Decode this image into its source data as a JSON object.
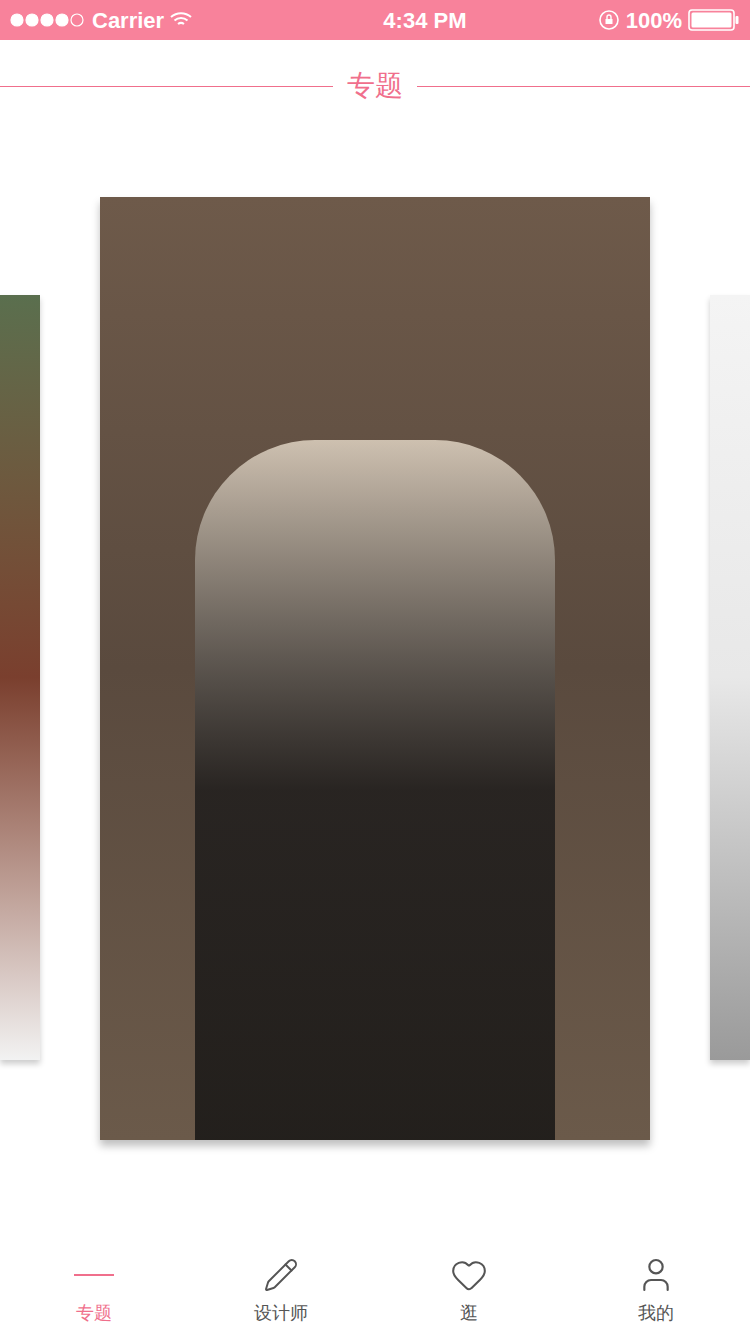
{
  "status_bar": {
    "carrier": "Carrier",
    "time": "4:34 PM",
    "battery": "100%",
    "signal_level": 0.8,
    "battery_level": 1
  },
  "header": {
    "title": "专题"
  },
  "carousel": {
    "cards": [
      {
        "selected": false
      },
      {
        "selected": true
      },
      {
        "selected": false
      }
    ]
  },
  "tab_bar": [
    {
      "label": "专题",
      "kind": "topic",
      "selected": true
    },
    {
      "label": "设计师",
      "kind": "designer",
      "selected": false
    },
    {
      "label": "逛",
      "kind": "browse",
      "selected": false
    },
    {
      "label": "我的",
      "kind": "me",
      "selected": false
    }
  ]
}
